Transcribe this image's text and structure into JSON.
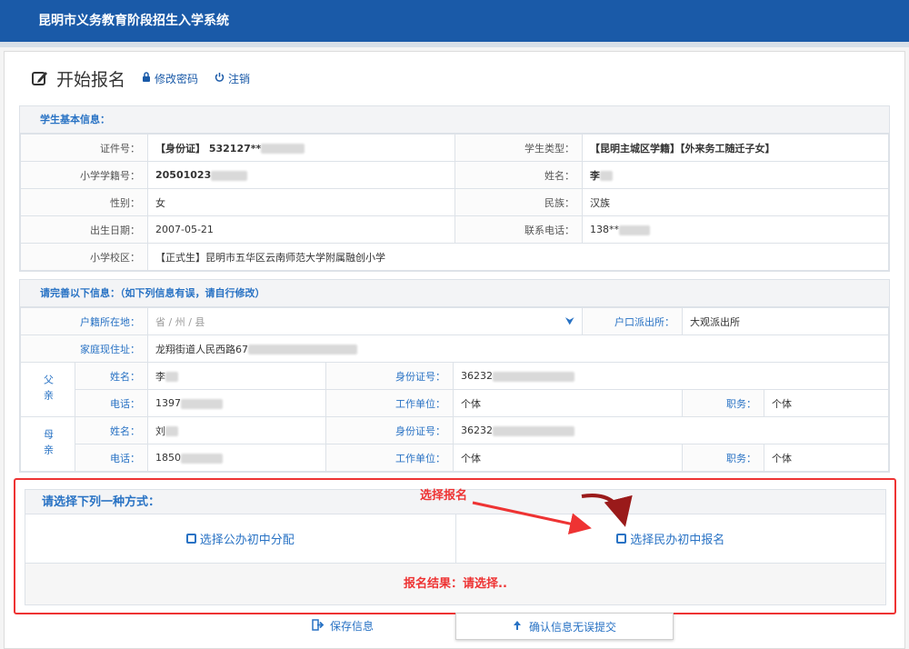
{
  "app": {
    "title": "昆明市义务教育阶段招生入学系统"
  },
  "header": {
    "title": "开始报名",
    "change_password": "修改密码",
    "logout": "注销"
  },
  "student": {
    "section_title": "学生基本信息：",
    "id_label": "证件号：",
    "id_value": "【身份证】 532127**",
    "type_label": "学生类型：",
    "type_value": "【昆明主城区学籍】【外来务工随迁子女】",
    "school_no_label": "小学学籍号：",
    "school_no_value": "20501023",
    "name_label": "姓名：",
    "name_value": "李",
    "gender_label": "性别：",
    "gender_value": "女",
    "ethnicity_label": "民族：",
    "ethnicity_value": "汉族",
    "birth_label": "出生日期：",
    "birth_value": "2007-05-21",
    "phone_label": "联系电话：",
    "phone_value": "138**",
    "campus_label": "小学校区：",
    "campus_value": "【正式生】昆明市五华区云南师范大学附属融创小学"
  },
  "complete": {
    "section_title": "请完善以下信息：（如下列信息有误，请自行修改）",
    "hukou_label": "户籍所在地：",
    "hukou_placeholder": "省 / 州 / 县",
    "police_label": "户口派出所：",
    "police_value": "大观派出所",
    "address_label": "家庭现住址：",
    "address_value": "龙翔街道人民西路67",
    "father": {
      "rel": "父亲",
      "name_label": "姓名：",
      "name_value": "李",
      "id_label": "身份证号：",
      "id_value": "36232",
      "phone_label": "电话：",
      "phone_value": "1397",
      "work_label": "工作单位：",
      "work_value": "个体",
      "job_label": "职务：",
      "job_value": "个体"
    },
    "mother": {
      "rel": "母亲",
      "name_label": "姓名：",
      "name_value": "刘",
      "id_label": "身份证号：",
      "id_value": "36232",
      "phone_label": "电话：",
      "phone_value": "1850",
      "work_label": "工作单位：",
      "work_value": "个体",
      "job_label": "职务：",
      "job_value": "个体"
    }
  },
  "choice": {
    "title": "请选择下列一种方式：",
    "annotation": "选择报名",
    "option_public": "选择公办初中分配",
    "option_private": "选择民办初中报名",
    "result": "报名结果：请选择.."
  },
  "footer": {
    "save": "保存信息",
    "submit": "确认信息无误提交"
  },
  "colors": {
    "brand": "#1a5aa8",
    "accent": "#2872c4",
    "alert": "#e33333"
  }
}
